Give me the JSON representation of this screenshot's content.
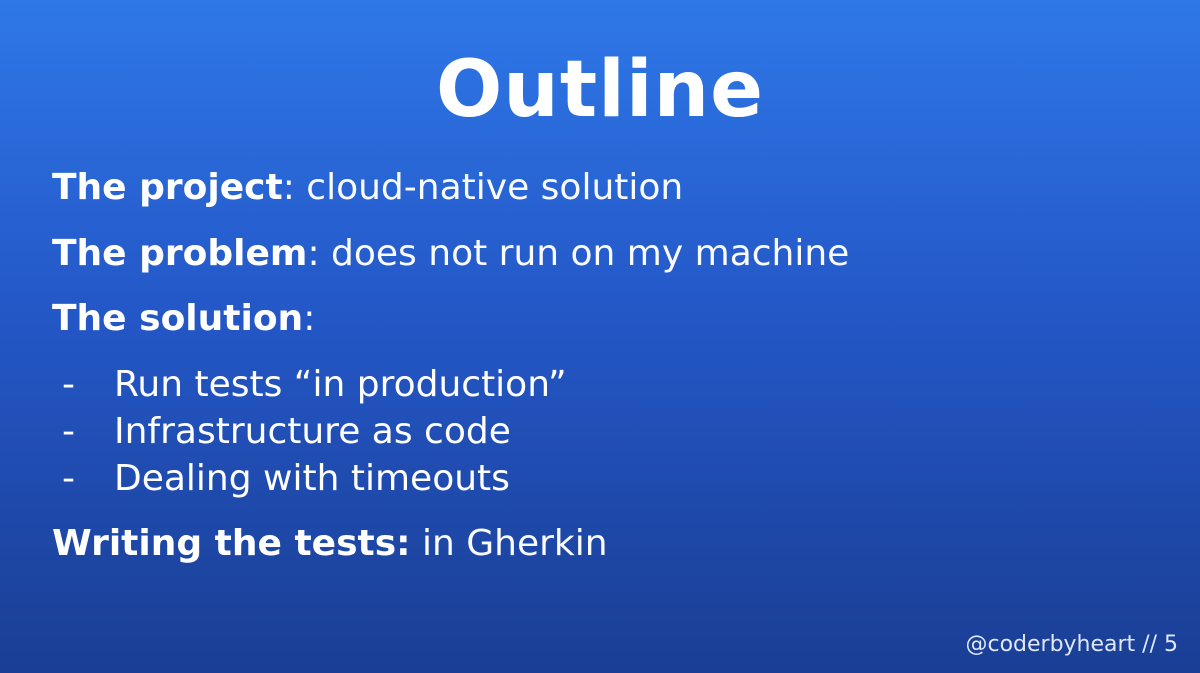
{
  "title": "Outline",
  "lines": [
    {
      "lead": "The project",
      "sep": ":",
      "rest": " cloud-native solution"
    },
    {
      "lead": "The problem",
      "sep": ":",
      "rest": " does not run on my machine"
    },
    {
      "lead": "The solution",
      "sep": ":",
      "rest": ""
    }
  ],
  "bullets": [
    {
      "dash": "-",
      "text": "Run tests “in production”"
    },
    {
      "dash": "-",
      "text": "Infrastructure as code"
    },
    {
      "dash": "-",
      "text": "Dealing with timeouts"
    }
  ],
  "writing": {
    "lead": "Writing the tests:",
    "rest": " in Gherkin"
  },
  "footer": "@coderbyheart // 5"
}
